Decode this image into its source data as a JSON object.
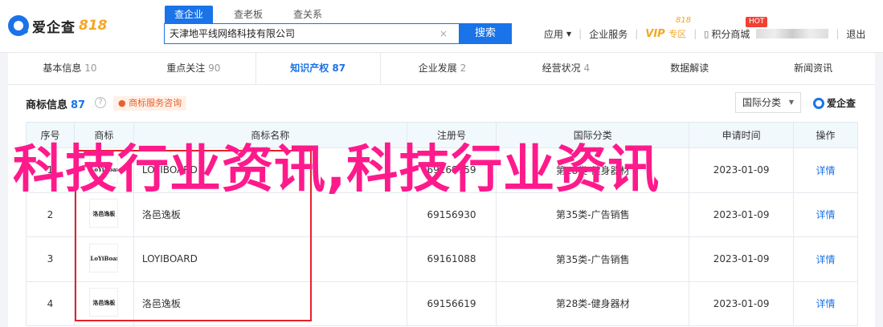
{
  "brand": {
    "name": "爱企查",
    "tag": "818"
  },
  "search": {
    "tabs": [
      "查企业",
      "查老板",
      "查关系"
    ],
    "active_tab": 0,
    "query": "天津地平线网络科技有限公司",
    "clear_label": "×",
    "button_label": "搜索"
  },
  "nav": {
    "app": "应用",
    "enterprise": "企业服务",
    "vip": "VIP",
    "vip_sub": "专区",
    "vip_badge": "818",
    "hot_badge": "HOT",
    "points": "积分商城",
    "logout": "退出"
  },
  "tabs": [
    {
      "label": "基本信息",
      "count": "10"
    },
    {
      "label": "重点关注",
      "count": "90"
    },
    {
      "label": "知识产权",
      "count": "87"
    },
    {
      "label": "企业发展",
      "count": "2"
    },
    {
      "label": "经营状况",
      "count": "4"
    },
    {
      "label": "数据解读",
      "count": ""
    },
    {
      "label": "新闻资讯",
      "count": ""
    }
  ],
  "section": {
    "title": "商标信息",
    "count": "87",
    "help": "?",
    "consult_label": "商标服务咨询",
    "filter_label": "国际分类",
    "brand_mark": "爱企查"
  },
  "table": {
    "headers": [
      "序号",
      "商标",
      "商标名称",
      "注册号",
      "国际分类",
      "申请时间",
      "操作"
    ],
    "rows": [
      {
        "index": "1",
        "logo": "LoYiBoard",
        "name": "LOYIBOARD",
        "reg_no": "69168759",
        "class": "第28类-健身器材",
        "date": "2023-01-09",
        "action": "详情"
      },
      {
        "index": "2",
        "logo": "洛邑逸板",
        "name": "洛邑逸板",
        "reg_no": "69156930",
        "class": "第35类-广告销售",
        "date": "2023-01-09",
        "action": "详情"
      },
      {
        "index": "3",
        "logo": "LoYiBoard",
        "name": "LOYIBOARD",
        "reg_no": "69161088",
        "class": "第35类-广告销售",
        "date": "2023-01-09",
        "action": "详情"
      },
      {
        "index": "4",
        "logo": "洛邑逸板",
        "name": "洛邑逸板",
        "reg_no": "69156619",
        "class": "第28类-健身器材",
        "date": "2023-01-09",
        "action": "详情"
      }
    ]
  },
  "watermark": "科技行业资讯,科技行业资讯",
  "colors": {
    "accent": "#1a73e8",
    "watermark": "#ff1a8c",
    "highlight_box": "#e8212b"
  }
}
